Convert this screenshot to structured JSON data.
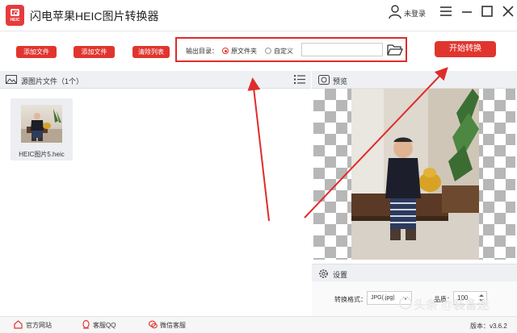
{
  "titlebar": {
    "app_title": "闪电苹果HEIC图片转换器",
    "logo_text": "HEIC",
    "user_label": "未登录"
  },
  "toolbar": {
    "add_file": "添加文件",
    "add_folder": "添加文件夹",
    "clear_list": "清除列表",
    "output_label": "输出目录：",
    "option_source": "原文件夹",
    "option_custom": "自定义",
    "output_path": "",
    "selected_option": "原文件夹",
    "start_button": "开始转换"
  },
  "left_panel": {
    "title": "源图片文件（1个）",
    "files": [
      {
        "name": "HEIC图片5.heic"
      }
    ]
  },
  "right_panel": {
    "preview_title": "预览",
    "settings_title": "设置",
    "format_label": "转换格式：",
    "format_value": "JPG(.jpg)",
    "quality_label": "品质：",
    "quality_value": "100"
  },
  "footer": {
    "website": "官方网站",
    "qq": "客服QQ",
    "wechat": "微信客服",
    "version": "版本：v3.6.2"
  },
  "watermark": "头条 @装备迷",
  "colors": {
    "accent": "#e0352e",
    "annotation": "#e02b2b",
    "panel_header": "#eef0f3"
  }
}
